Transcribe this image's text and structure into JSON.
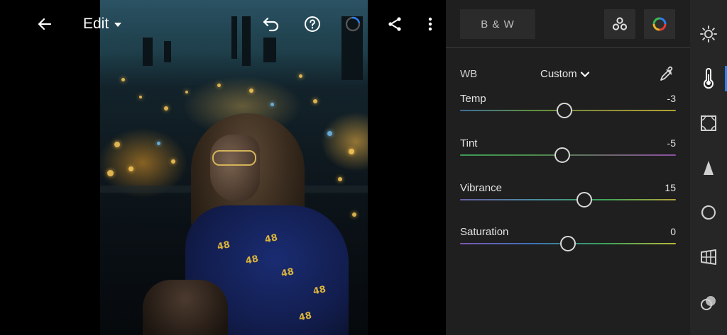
{
  "header": {
    "title": "Edit"
  },
  "icons": {
    "back": "arrow-left-icon",
    "undo": "undo-icon",
    "help": "help-icon",
    "progress": "progress-ring-icon",
    "share": "share-icon",
    "more": "more-vertical-icon"
  },
  "panel": {
    "bw_label": "B & W",
    "profiles_icon": "profiles-icon",
    "color_mix_icon": "color-mix-icon",
    "wb": {
      "label": "WB",
      "value": "Custom"
    },
    "sliders": [
      {
        "name": "Temp",
        "value": "-3",
        "position": 0.485,
        "gradient": [
          "#3c6d9c",
          "#5e8f3e",
          "#8e8c3a",
          "#b2a430"
        ]
      },
      {
        "name": "Tint",
        "value": "-5",
        "position": 0.475,
        "gradient": [
          "#3f9a57",
          "#4c8a4c",
          "#6b6a6a",
          "#8e4fa2"
        ]
      },
      {
        "name": "Vibrance",
        "value": "15",
        "position": 0.575,
        "gradient": [
          "#6a60a8",
          "#4a8aa0",
          "#3fa35a",
          "#b5a43a"
        ]
      },
      {
        "name": "Saturation",
        "value": "0",
        "position": 0.5,
        "gradient": [
          "#7a5ab0",
          "#3c70b8",
          "#3aa35a",
          "#b8b83a"
        ]
      }
    ]
  },
  "rail": {
    "items": [
      "light-icon",
      "color-temperature-icon",
      "effects-icon",
      "detail-icon",
      "optics-icon",
      "geometry-icon",
      "presets-icon"
    ],
    "active_index": 1,
    "accent": "#2f7ff0"
  },
  "photo": {
    "jersey_number": "48"
  }
}
